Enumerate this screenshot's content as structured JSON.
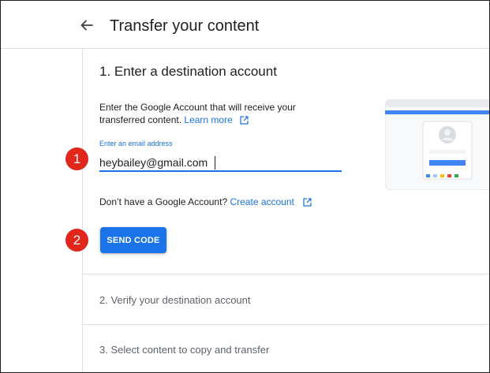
{
  "header": {
    "title": "Transfer your content",
    "back_icon": "arrow-back-icon"
  },
  "step1": {
    "title": "1. Enter a destination account",
    "description": "Enter the Google Account that will receive your transferred content.",
    "learn_more": "Learn more",
    "email": {
      "label": "Enter an email address",
      "value": "heybailey@gmail.com"
    },
    "no_account_text": "Don’t have a Google Account?",
    "create_account": "Create account",
    "send_code": "SEND CODE"
  },
  "step2": {
    "title": "2. Verify your destination account"
  },
  "step3": {
    "title": "3. Select content to copy and transfer"
  },
  "callouts": [
    "1",
    "2"
  ],
  "colors": {
    "accent": "#1a73e8",
    "callout": "#e1261c",
    "muted_text": "#5f6368",
    "divider": "#e0e0e0"
  }
}
